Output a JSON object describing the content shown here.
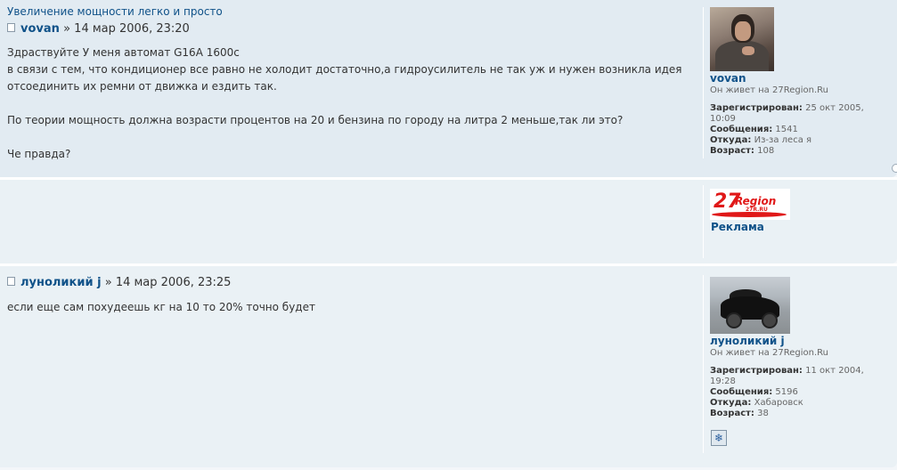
{
  "topic": {
    "title": "Увеличение мощности легко и просто"
  },
  "posts": [
    {
      "author": "vovan",
      "separator": "»",
      "date": "14 мар 2006, 23:20",
      "lines": [
        "Здраствуйте У меня автомат G16A 1600c",
        "в связи с тем, что кондиционер все равно не холодит достаточно,а гидроусилитель не так уж и нужен возникла идея",
        "отсоединить их ремни от движка и ездить так.",
        "",
        "По теории мощность должна возрасти процентов на 20 и бензина по городу на литра 2 меньше,так ли это?",
        "",
        "Че правда?"
      ],
      "profile": {
        "username": "vovan",
        "rank": "Он живет на 27Region.Ru",
        "registered_label": "Зарегистрирован:",
        "registered_value": "25 окт 2005, 10:09",
        "posts_label": "Сообщения:",
        "posts_value": "1541",
        "from_label": "Откуда:",
        "from_value": "Из-за леса я",
        "age_label": "Возраст:",
        "age_value": "108"
      }
    },
    {
      "author": "луноликий j",
      "separator": "»",
      "date": "14 мар 2006, 23:25",
      "lines": [
        "если еще сам похудеешь кг на 10 то 20% точно будет"
      ],
      "profile": {
        "username": "луноликий j",
        "rank": "Он живет на 27Region.Ru",
        "registered_label": "Зарегистрирован:",
        "registered_value": "11 окт 2004, 19:28",
        "posts_label": "Сообщения:",
        "posts_value": "5196",
        "from_label": "Откуда:",
        "from_value": "Хабаровск",
        "age_label": "Возраст:",
        "age_value": "38"
      }
    }
  ],
  "ad": {
    "logo_number": "27",
    "logo_word": "Region",
    "logo_sub": "27R.RU",
    "label": "Реклама"
  },
  "icons": {
    "post": "post-icon",
    "profile_extra": "snowflake-icon"
  },
  "colors": {
    "link": "#105289",
    "post_bg_1": "#e2ebf2",
    "post_bg_2": "#eaf1f5",
    "logo_red": "#e01818"
  }
}
